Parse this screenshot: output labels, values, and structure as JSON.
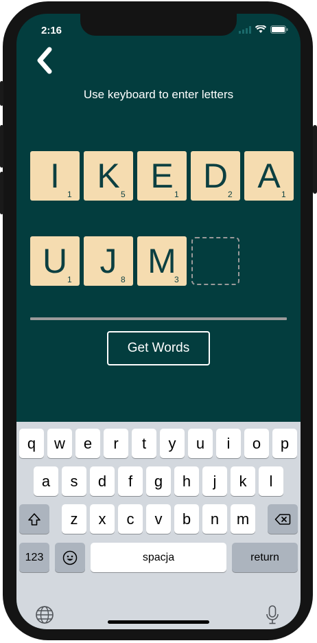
{
  "status_bar": {
    "time": "2:16"
  },
  "header": {
    "back_icon": "chevron-left-icon"
  },
  "hint_text": "Use keyboard to enter letters",
  "tiles_row1": [
    {
      "letter": "I",
      "score": "1"
    },
    {
      "letter": "K",
      "score": "5"
    },
    {
      "letter": "E",
      "score": "1"
    },
    {
      "letter": "D",
      "score": "2"
    },
    {
      "letter": "A",
      "score": "1"
    }
  ],
  "tiles_row2": [
    {
      "letter": "U",
      "score": "1"
    },
    {
      "letter": "J",
      "score": "8"
    },
    {
      "letter": "M",
      "score": "3"
    }
  ],
  "get_words_label": "Get Words",
  "keyboard": {
    "row1": [
      "q",
      "w",
      "e",
      "r",
      "t",
      "y",
      "u",
      "i",
      "o",
      "p"
    ],
    "row2": [
      "a",
      "s",
      "d",
      "f",
      "g",
      "h",
      "j",
      "k",
      "l"
    ],
    "row3": [
      "z",
      "x",
      "c",
      "v",
      "b",
      "n",
      "m"
    ],
    "numbers_label": "123",
    "space_label": "spacja",
    "return_label": "return"
  },
  "colors": {
    "background": "#033d3e",
    "tile": "#f5dcb0",
    "tile_text": "#0c3f41"
  }
}
